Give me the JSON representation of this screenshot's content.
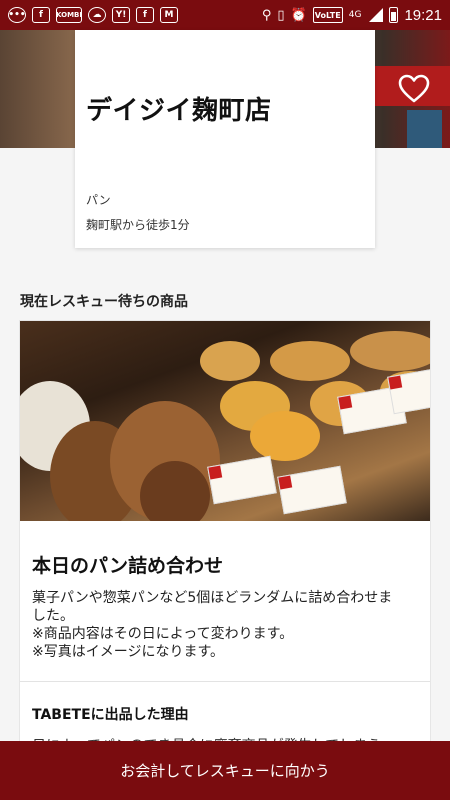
{
  "statusbar": {
    "time": "19:21",
    "network": "4G",
    "volte": "VoLTE",
    "left_icons": [
      "menu-icon",
      "facebook-icon",
      "kombi-icon",
      "weather-icon",
      "yahoo-icon",
      "facebook-icon",
      "gmail-icon"
    ],
    "right_icons": [
      "location-icon",
      "vibrate-icon",
      "alarm-icon",
      "volte-icon",
      "signal-icon",
      "battery-icon"
    ]
  },
  "shop": {
    "name": "デイジイ麹町店",
    "category": "パン",
    "access": "麹町駅から徒歩1分"
  },
  "section": {
    "title": "現在レスキュー待ちの商品"
  },
  "product": {
    "title": "本日のパン詰め合わせ",
    "description": [
      "菓子パンや惣菜パンなど5個ほどランダムに詰め合わせま",
      "した。",
      "※商品内容はその日によって変わります。",
      "※写真はイメージになります。"
    ],
    "reason_title": "TABETEに出品した理由",
    "reason_text": "日によってパンのでき具合に廃棄商品が発生してしまう"
  },
  "cta": {
    "label": "お会計してレスキューに向かう"
  },
  "colors": {
    "brand": "#7a0c0f",
    "background": "#f5f5f5"
  }
}
